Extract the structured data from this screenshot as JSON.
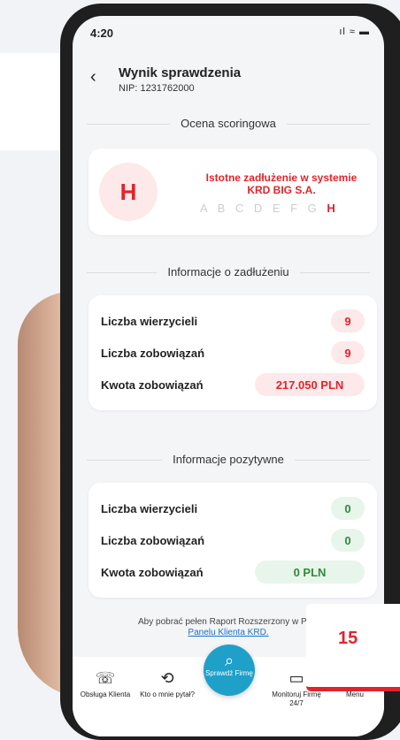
{
  "status_bar": {
    "time": "4:20",
    "icons": "ıl ≈ ▬"
  },
  "header": {
    "title": "Wynik sprawdzenia",
    "nip": "NIP: 1231762000"
  },
  "scoring": {
    "section_title": "Ocena scoringowa",
    "grade": "H",
    "description": "Istotne zadłużenie w systemie KRD BIG S.A.",
    "scale_inactive": "A B C D E F G",
    "scale_active": "H"
  },
  "debt": {
    "section_title": "Informacje o zadłużeniu",
    "rows": [
      {
        "label": "Liczba wierzycieli",
        "value": "9"
      },
      {
        "label": "Liczba zobowiązań",
        "value": "9"
      },
      {
        "label": "Kwota zobowiązań",
        "value": "217.050 PLN"
      }
    ]
  },
  "positive": {
    "section_title": "Informacje pozytywne",
    "rows": [
      {
        "label": "Liczba wierzycieli",
        "value": "0"
      },
      {
        "label": "Liczba zobowiązań",
        "value": "0"
      },
      {
        "label": "Kwota zobowiązań",
        "value": "0 PLN"
      }
    ]
  },
  "footer_note": {
    "text": "Aby pobrać pełen Raport Rozszerzony w PDF",
    "link": "Panelu Klienta KRD."
  },
  "nav": {
    "items": [
      {
        "label": "Obsługa Klienta",
        "icon": "☏"
      },
      {
        "label": "Kto o mnie pytał?",
        "icon": "⟲"
      },
      {
        "label": "Sprawdź Firmę",
        "icon": "⌕"
      },
      {
        "label": "Monitoruj Firmę 24/7",
        "icon": "▭"
      },
      {
        "label": "Menu",
        "icon": "☰"
      }
    ]
  },
  "badge": {
    "number": "15"
  },
  "colors": {
    "accent_red": "#e3232b",
    "accent_blue": "#1ea0c9",
    "positive_green": "#2f8a3a"
  }
}
